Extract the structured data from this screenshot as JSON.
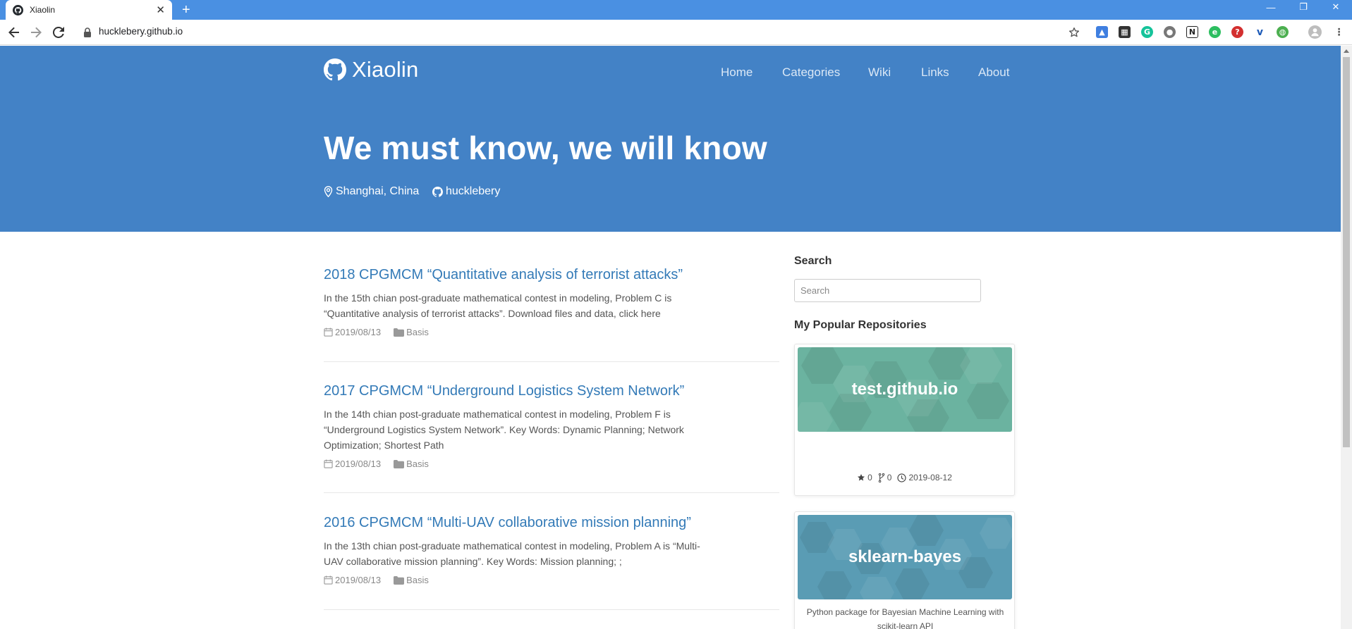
{
  "browser": {
    "tab_title": "Xiaolin",
    "url": "hucklebery.github.io",
    "new_tab_symbol": "+",
    "close_tab_symbol": "✕",
    "window_controls": {
      "minimize": "—",
      "restore": "❐",
      "close": "✕"
    },
    "extension_icons": [
      "graduation-cap-icon",
      "dashboard-icon",
      "grammarly-icon",
      "circle-extension-icon",
      "notion-icon",
      "evernote-icon",
      "help-extension-icon",
      "v-extension-icon",
      "earth-extension-icon"
    ]
  },
  "site": {
    "brand": "Xiaolin",
    "nav": [
      "Home",
      "Categories",
      "Wiki",
      "Links",
      "About"
    ],
    "hero_title": "We must know, we will know",
    "location": "Shanghai, China",
    "github_user": "hucklebery",
    "hero_color": "#4382c6",
    "link_color": "#337ab7"
  },
  "posts": [
    {
      "title": "2018 CPGMCM “Quantitative analysis of terrorist attacks”",
      "excerpt": "In the 15th chian post-graduate mathematical contest in modeling, Problem C is “Quantitative analysis of terrorist attacks”. Download files and data, click here",
      "date": "2019/08/13",
      "category": "Basis"
    },
    {
      "title": "2017 CPGMCM “Underground Logistics System Network”",
      "excerpt": "In the 14th chian post-graduate mathematical contest in modeling, Problem F is “Underground Logistics System Network”. Key Words: Dynamic Planning; Network Optimization; Shortest Path",
      "date": "2019/08/13",
      "category": "Basis"
    },
    {
      "title": "2016 CPGMCM “Multi-UAV collaborative mission planning”",
      "excerpt": "In the 13th chian post-graduate mathematical contest in modeling, Problem A is “Multi-UAV collaborative mission planning”. Key Words: Mission planning; ;",
      "date": "2019/08/13",
      "category": "Basis"
    }
  ],
  "sidebar": {
    "search_heading": "Search",
    "search_placeholder": "Search",
    "repos_heading": "My Popular Repositories",
    "repos": [
      {
        "name": "test.github.io",
        "description": "",
        "stars": "0",
        "forks": "0",
        "updated": "2019-08-12",
        "color": "#6bb3a0"
      },
      {
        "name": "sklearn-bayes",
        "description": "Python package for Bayesian Machine Learning with scikit-learn API",
        "color": "#5a9cb4"
      }
    ]
  }
}
